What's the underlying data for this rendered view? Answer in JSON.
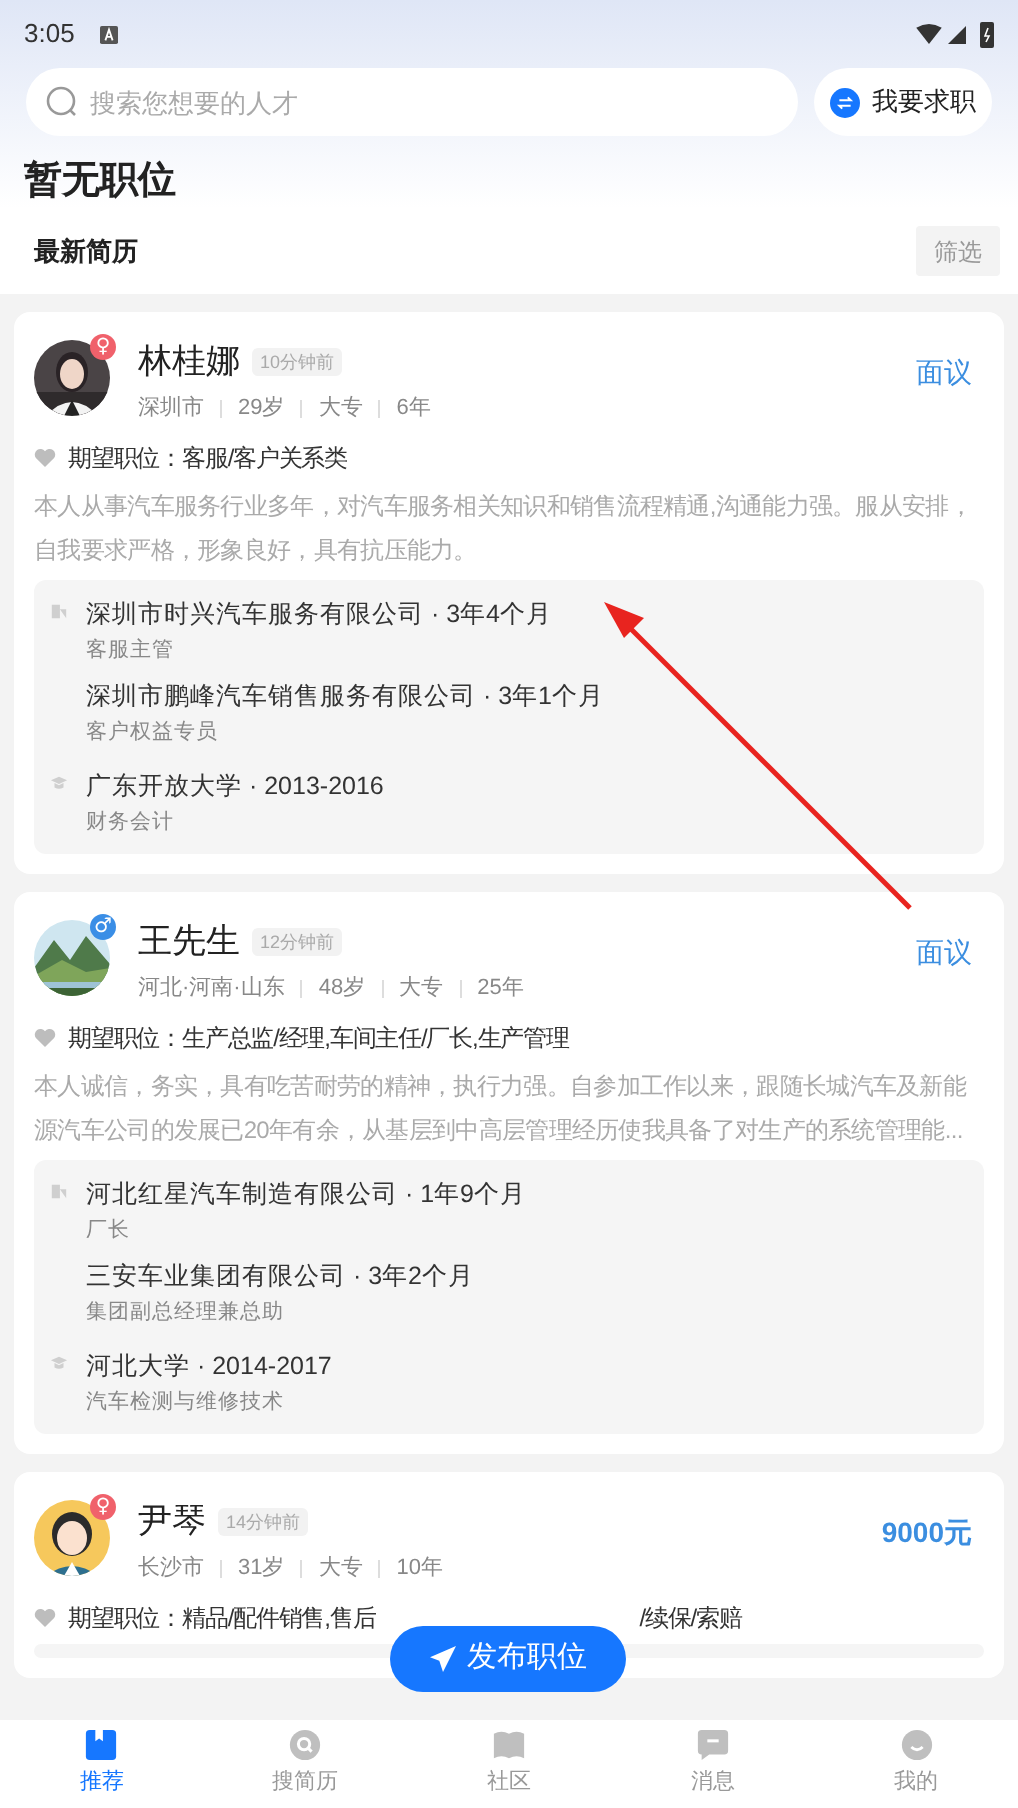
{
  "status_bar": {
    "time": "3:05"
  },
  "search": {
    "placeholder": "搜索您想要的人才"
  },
  "switch_button": {
    "label": "我要求职"
  },
  "page_title": "暂无职位",
  "section": {
    "title": "最新简历",
    "filter": "筛选"
  },
  "resumes": [
    {
      "name": "林桂娜",
      "gender": "♀",
      "color": "#f0616b",
      "time": "10分钟前",
      "meta": [
        "深圳市",
        "29岁",
        "大专",
        "6年"
      ],
      "salary": "面议",
      "expect_label": "期望职位：",
      "expect": "客服/客户关系类",
      "description": "本人从事汽车服务行业多年，对汽车服务相关知识和销售流程精通,沟通能力强。服从安排，自我要求严格，形象良好，具有抗压能力。",
      "work": [
        {
          "title": "深圳市时兴汽车服务有限公司 · 3年4个月",
          "role": "客服主管"
        },
        {
          "title": "深圳市鹏峰汽车销售服务有限公司 · 3年1个月",
          "role": "客户权益专员"
        }
      ],
      "education": [
        {
          "title": "广东开放大学 · 2013-2016",
          "major": "财务会计"
        }
      ]
    },
    {
      "name": "王先生",
      "gender": "♂",
      "color": "#3a8ee6",
      "time": "12分钟前",
      "meta": [
        "河北·河南·山东",
        "48岁",
        "大专",
        "25年"
      ],
      "salary": "面议",
      "expect_label": "期望职位：",
      "expect": "生产总监/经理,车间主任/厂长,生产管理",
      "description": "本人诚信，务实，具有吃苦耐劳的精神，执行力强。自参加工作以来，跟随长城汽车及新能源汽车公司的发展已20年有余，从基层到中高层管理经历使我具备了对生产的系统管理能...",
      "work": [
        {
          "title": "河北红星汽车制造有限公司 · 1年9个月",
          "role": "厂长"
        },
        {
          "title": "三安车业集团有限公司 · 3年2个月",
          "role": "集团副总经理兼总助"
        }
      ],
      "education": [
        {
          "title": "河北大学 · 2014-2017",
          "major": "汽车检测与维修技术"
        }
      ]
    },
    {
      "name": "尹琴",
      "gender": "♀",
      "color": "#f0616b",
      "time": "14分钟前",
      "meta": [
        "长沙市",
        "31岁",
        "大专",
        "10年"
      ],
      "salary": "9000元",
      "expect_label": "期望职位：",
      "expect": "精品/配件销售,售后",
      "expect_tail": "/续保/索赔"
    }
  ],
  "post_button": {
    "label": "发布职位"
  },
  "nav": [
    {
      "label": "推荐",
      "selected": true
    },
    {
      "label": "搜简历",
      "selected": false
    },
    {
      "label": "社区",
      "selected": false
    },
    {
      "label": "消息",
      "selected": false
    },
    {
      "label": "我的",
      "selected": false
    }
  ]
}
